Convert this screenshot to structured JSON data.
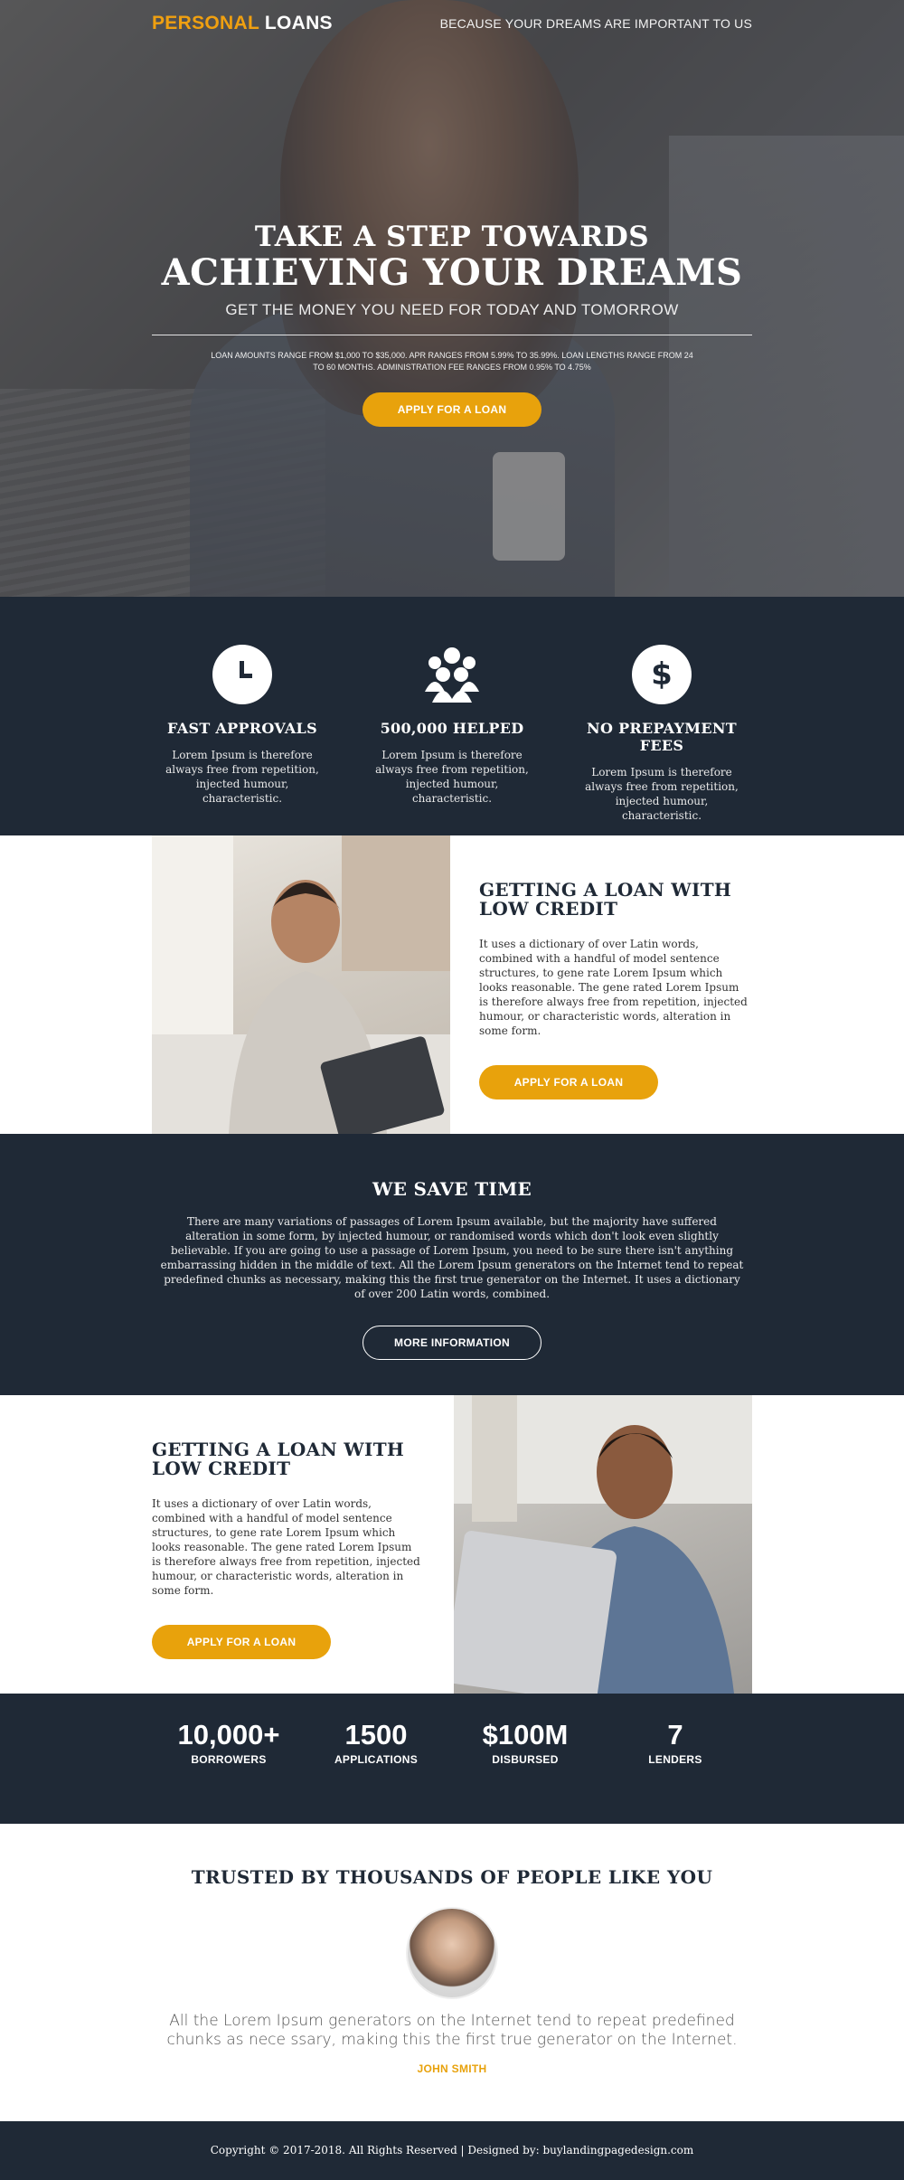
{
  "header": {
    "logo_part1": "PERSONAL",
    "logo_part2": "LOANS",
    "tagline": "BECAUSE YOUR DREAMS ARE IMPORTANT TO US"
  },
  "hero": {
    "title_line1": "TAKE A STEP TOWARDS",
    "title_line2": "ACHIEVING YOUR DREAMS",
    "subtitle": "GET THE MONEY YOU NEED FOR TODAY AND TOMORROW",
    "disclaimer": "LOAN AMOUNTS RANGE FROM $1,000 TO $35,000. APR RANGES FROM 5.99% TO 35.99%. LOAN LENGTHS RANGE FROM 24 TO 60 MONTHS. ADMINISTRATION FEE RANGES FROM 0.95% TO 4.75%",
    "cta_label": "APPLY FOR A LOAN"
  },
  "features": [
    {
      "icon": "clock-icon",
      "title": "FAST APPROVALS",
      "text": "Lorem Ipsum is therefore always free from repetition, injected humour, characteristic."
    },
    {
      "icon": "group-icon",
      "title": "500,000 HELPED",
      "text": "Lorem Ipsum is therefore always free from repetition, injected humour, characteristic."
    },
    {
      "icon": "dollar-icon",
      "title": "NO PREPAYMENT FEES",
      "text": "Lorem Ipsum is therefore always free from repetition, injected humour, characteristic."
    }
  ],
  "loan_section_1": {
    "title_line1": "GETTING A LOAN WITH",
    "title_line2": "LOW CREDIT",
    "body": "It uses a dictionary of over Latin words, combined with a handful of model sentence structures, to gene rate Lorem Ipsum which looks reasonable. The gene rated Lorem Ipsum is therefore always free from repetition, injected humour, or characteristic words, alteration in some form.",
    "cta_label": "APPLY FOR A LOAN"
  },
  "save_time": {
    "title": "WE SAVE TIME",
    "body": "There are many variations of passages of Lorem Ipsum available, but the majority have suffered alteration in some form, by injected humour, or randomised words which don't look even slightly believable. If you are going to use a passage of Lorem Ipsum, you need to be sure there isn't anything embarrassing hidden in the middle of text. All the Lorem Ipsum generators on the Internet tend to repeat predefined chunks as necessary, making this the first true generator on the Internet. It uses a dictionary of over 200 Latin words, combined.",
    "cta_label": "MORE INFORMATION"
  },
  "loan_section_2": {
    "title_line1": "GETTING A LOAN WITH",
    "title_line2": "LOW CREDIT",
    "body": "It uses a dictionary of over Latin words, combined with a handful of model sentence structures, to gene rate Lorem Ipsum which looks reasonable. The gene rated Lorem Ipsum is therefore always free from repetition, injected humour, or characteristic words, alteration in some form.",
    "cta_label": "APPLY FOR A LOAN"
  },
  "stats": [
    {
      "number": "10,000+",
      "label": "BORROWERS"
    },
    {
      "number": "1500",
      "label": "APPLICATIONS"
    },
    {
      "number": "$100M",
      "label": "DISBURSED"
    },
    {
      "number": "7",
      "label": "LENDERS"
    }
  ],
  "testimonial": {
    "title": "TRUSTED BY THOUSANDS OF PEOPLE LIKE YOU",
    "quote": "All the Lorem Ipsum generators on the Internet tend to repeat predefined chunks as nece ssary, making this the first true generator on the Internet.",
    "author": "JOHN SMITH"
  },
  "footer": {
    "text": "Copyright © 2017-2018. All Rights Reserved  |  Designed by: buylandingpagedesign.com"
  },
  "colors": {
    "accent": "#e8a20c",
    "navy": "#1f2936"
  }
}
